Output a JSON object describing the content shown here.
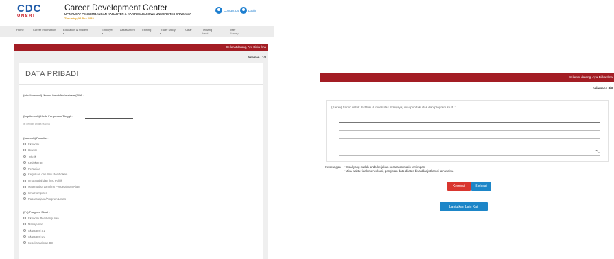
{
  "left": {
    "logo": {
      "main": "CDC",
      "sub": "UNSRI"
    },
    "header": {
      "title": "Career Development Center",
      "subtitle": "UPT. PUSAT PENGEMBANGAN KARAKTER & KARIR MAHASISWA UNIVERSITAS SRIWIJAYA",
      "date": "Thursday, 10 Dec 2020",
      "contact_label": "Contact Us",
      "login_label": "Login"
    },
    "nav": [
      {
        "label": "Home",
        "caret": ""
      },
      {
        "label": "Career Information",
        "caret": ""
      },
      {
        "label": "Education & Student",
        "caret": "▾"
      },
      {
        "label": "Employer",
        "caret": "▾"
      },
      {
        "label": "Assessment",
        "caret": ""
      },
      {
        "label": "Training",
        "caret": ""
      },
      {
        "label": "Tracer Study",
        "caret": "▾"
      },
      {
        "label": "Kabar",
        "caret": ""
      },
      {
        "label": "Tentang",
        "caret": "kami"
      },
      {
        "label": "User",
        "caret": "Survey"
      }
    ],
    "welcome": "Selamat datang, Ayu Birka Ilma",
    "page": "halaman : 1/3",
    "card_title": "DATA PRIBADI",
    "q_nim": "(nimHorsonal) Nomor Induk Mahasiswa (NIM) :",
    "q_kode": "(kdptimsmh) Kode Perguruan Tinggi :",
    "q_kode_hint": "isi dengan angka 001001",
    "q_fakultas": "(fakmmh) Fakultas :",
    "fakultas_options": [
      "Ekonomi",
      "Hukum",
      "Teknik",
      "Kedokteran",
      "Pertanian",
      "Keguruan dan Ilmu Pendidikan",
      "Ilmu Sosial dan Ilmu Politik",
      "Matematika dan Ilmu Pengetahuan Alam",
      "Ilmu Komputer",
      "Pascasarjana/Program Lintas"
    ],
    "q_prodi": "(P4) Program Studi :",
    "prodi_options": [
      "Ekonomi Pembangunan",
      "Manajemen",
      "Akuntansi S1",
      "Akuntansi D3",
      "Kesekretariatan D3"
    ]
  },
  "right": {
    "welcome": "Selamat datang, Ayu Birka Ilma",
    "page": "halaman : 3/3",
    "feedback_label": "(Saran) Saran untuk Institusi (Universitas Sriwijaya) maupun fakultas dan program studi :",
    "keterangan_label": "Keterangan :",
    "notes": [
      "Soal yang sudah anda kerjakan secara otomatis tersimpan.",
      "Jika waktu tidak mencukupi, pengisian data di atas bisa dilanjutkan di lain waktu."
    ],
    "back_label": "Kembali",
    "done_label": "Selesai",
    "continue_label": "Lanjutkan Lain Kali",
    "resize_icon": "resize-handle-icon"
  },
  "colors": {
    "accent_red": "#a31d24",
    "button_red": "#d9362f",
    "button_blue": "#1d86c8",
    "brand_blue": "#1e5aa8"
  }
}
